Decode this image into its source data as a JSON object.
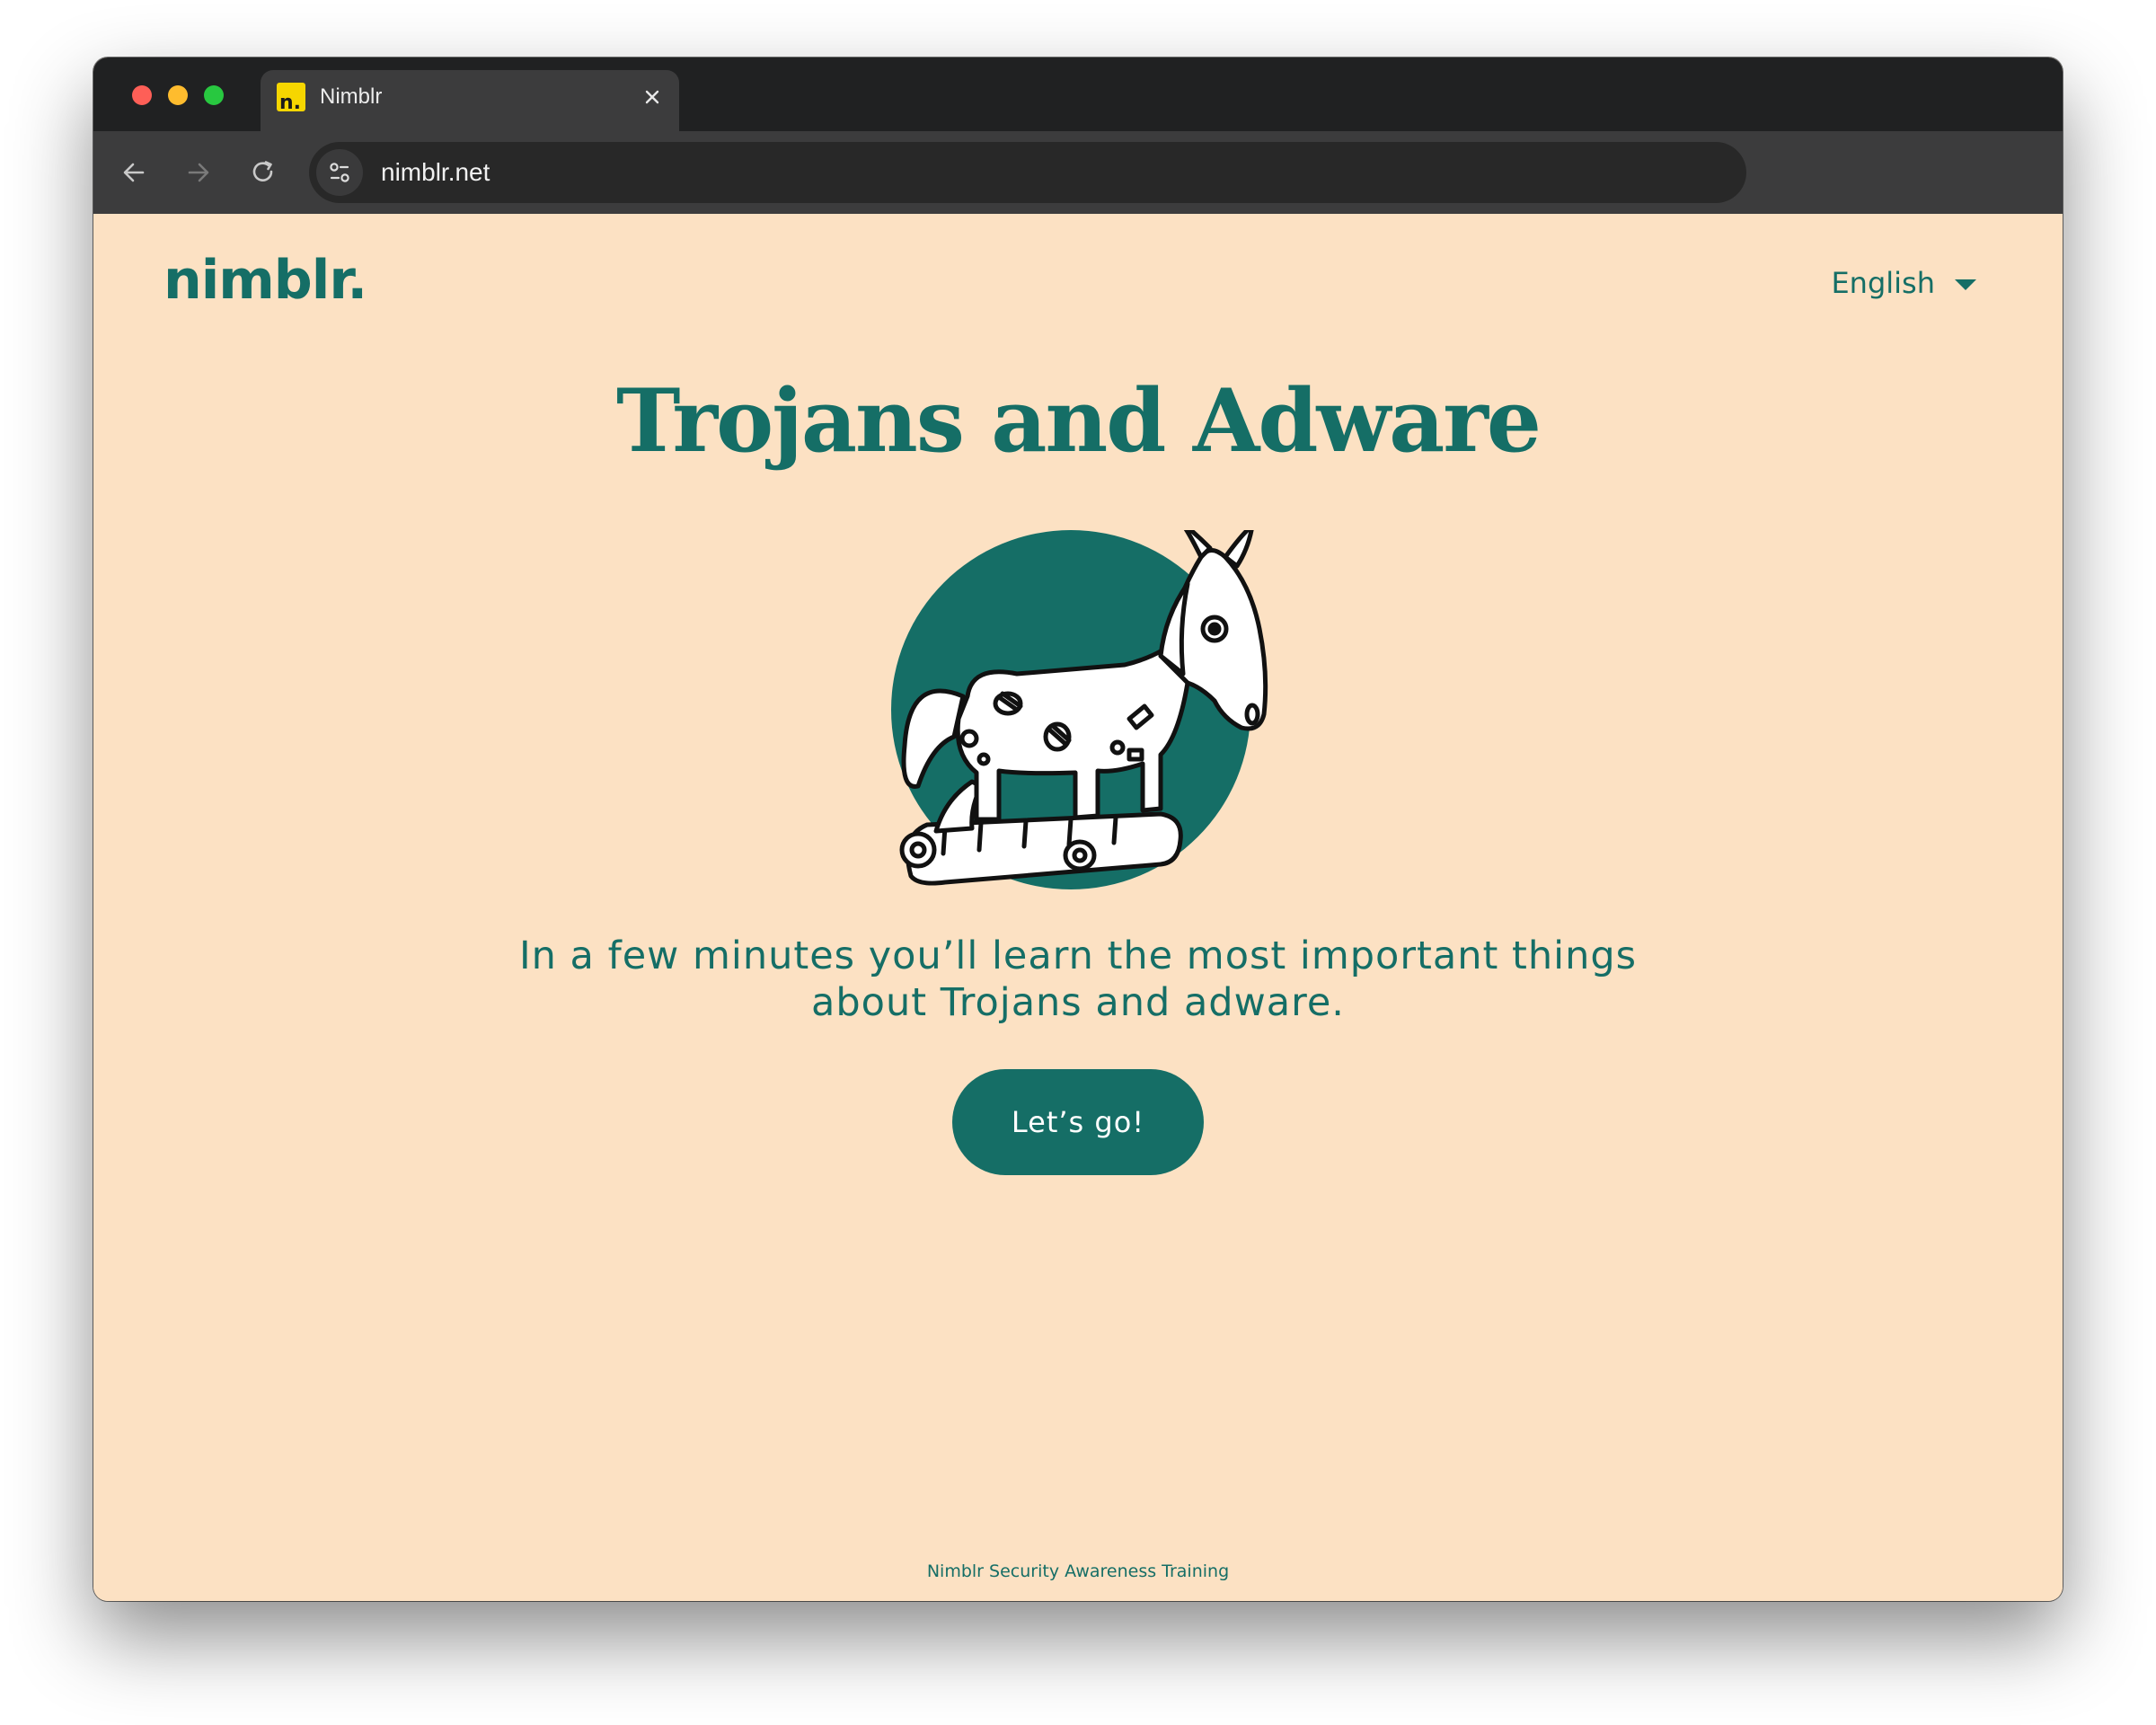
{
  "browser": {
    "tab": {
      "title": "Nimblr",
      "favicon_letter": "n."
    },
    "address_bar": {
      "url": "nimblr.net"
    }
  },
  "page": {
    "logo": "nimblr.",
    "language": {
      "selected": "English"
    },
    "headline": "Trojans and Adware",
    "lead_line_1": "In a few minutes you’ll learn the most important things",
    "lead_line_2": "about Trojans and adware.",
    "cta_label": "Let’s go!",
    "footer": "Nimblr Security Awareness Training"
  },
  "colors": {
    "brand": "#156e66",
    "background": "#fce1c3",
    "favicon": "#f6d600"
  },
  "icons": {
    "back": "arrow-left-icon",
    "forward": "arrow-right-icon",
    "reload": "reload-icon",
    "site_info": "tune-icon",
    "tab_close": "close-icon",
    "language_caret": "caret-down-icon",
    "illustration": "trojan-horse-illustration"
  }
}
